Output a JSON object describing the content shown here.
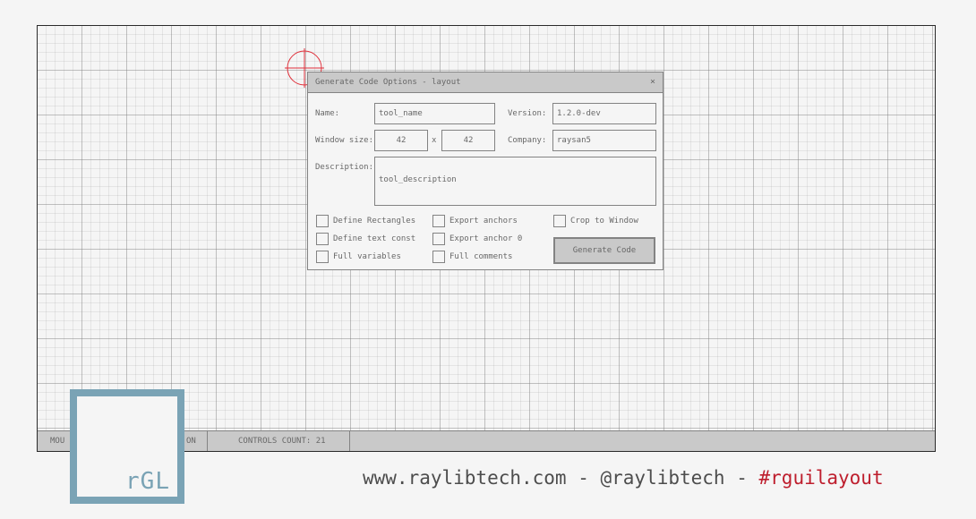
{
  "statusbar": {
    "mouse_prefix": "MOU",
    "mode_suffix": "ON",
    "controls_count": "CONTROLS COUNT: 21"
  },
  "dialog": {
    "title": "Generate Code Options - layout",
    "close_label": "×",
    "name_label": "Name:",
    "name_value": "tool_name",
    "version_label": "Version:",
    "version_value": "1.2.0-dev",
    "window_size_label": "Window size:",
    "width_value": "42",
    "size_separator": "x",
    "height_value": "42",
    "company_label": "Company:",
    "company_value": "raysan5",
    "description_label": "Description:",
    "description_value": "tool_description",
    "checkboxes": {
      "define_rectangles": "Define Rectangles",
      "export_anchors": "Export anchors",
      "crop_to_window": "Crop to Window",
      "define_text_const": "Define text const",
      "export_anchor_0": "Export anchor 0",
      "full_variables": "Full variables",
      "full_comments": "Full comments"
    },
    "generate_button": "Generate Code"
  },
  "logo": {
    "text": "rGL"
  },
  "footer": {
    "site": "www.raylibtech.com - @raylibtech - ",
    "hashtag": "#rguilayout"
  },
  "colors": {
    "accent": "#7aa3b5",
    "hashtag": "#be1e2d",
    "crosshair": "#e0303a"
  }
}
